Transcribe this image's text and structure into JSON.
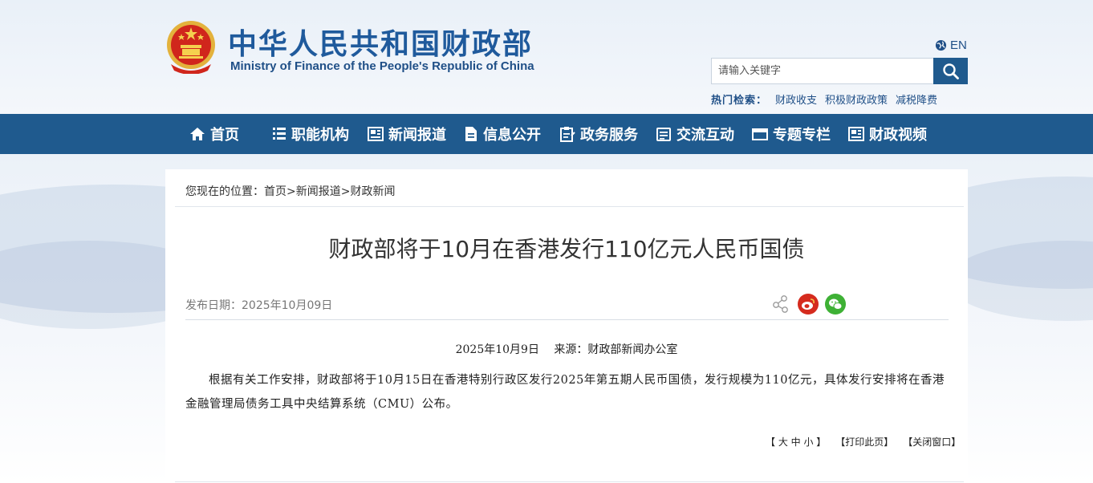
{
  "header": {
    "title_cn": "中华人民共和国财政部",
    "title_en": "Ministry of Finance of the People's Republic of China",
    "lang_label": "EN",
    "search_placeholder": "请输入关键字",
    "hot_label": "热门检索：",
    "hot_links": [
      "财政收支",
      "积极财政政策",
      "减税降费"
    ]
  },
  "nav": {
    "items": [
      {
        "label": "首页",
        "icon": "home-icon"
      },
      {
        "label": "职能机构",
        "icon": "list-icon"
      },
      {
        "label": "新闻报道",
        "icon": "news-icon"
      },
      {
        "label": "信息公开",
        "icon": "document-icon"
      },
      {
        "label": "政务服务",
        "icon": "clipboard-icon"
      },
      {
        "label": "交流互动",
        "icon": "chat-icon"
      },
      {
        "label": "专题专栏",
        "icon": "window-icon"
      },
      {
        "label": "财政视频",
        "icon": "video-icon"
      }
    ]
  },
  "breadcrumb": {
    "prefix": "您现在的位置：",
    "items": [
      "首页",
      "新闻报道",
      "财政新闻"
    ],
    "separator": ">"
  },
  "article": {
    "title": "财政部将于10月在香港发行110亿元人民币国债",
    "pub_date": "发布日期：2025年10月09日",
    "source_line": "2025年10月9日　 来源：财政部新闻办公室",
    "body": "根据有关工作安排，财政部将于10月15日在香港特别行政区发行2025年第五期人民币国债，发行规模为110亿元，具体发行安排将在香港金融管理局债务工具中央结算系统（CMU）公布。"
  },
  "tools": {
    "font_size": "【 大 中 小 】",
    "print": "【打印此页】",
    "close": "【关闭窗口】"
  },
  "colors": {
    "primary_blue": "#1f5a8e",
    "title_blue": "#1f5a9c",
    "weibo_red": "#d52b1e",
    "wechat_green": "#3eb135"
  }
}
